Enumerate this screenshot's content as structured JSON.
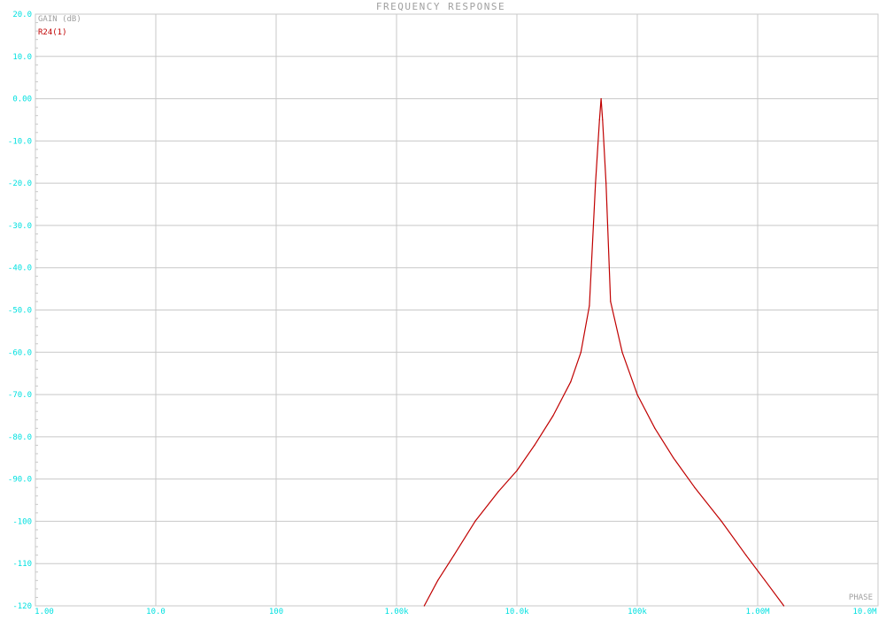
{
  "window": {
    "title": "FREQUENCY RESPONSE",
    "y_axis_title": "GAIN (dB)",
    "series_label": "R24(1)",
    "secondary_label": "PHASE"
  },
  "colors": {
    "background": "#ffffff",
    "grid": "#c8c8c8",
    "tick_text": "#00e0e0",
    "title_text": "#a0a0a0",
    "series": "#c00000"
  },
  "chart_data": {
    "type": "line",
    "title": "FREQUENCY RESPONSE",
    "xlabel": "",
    "ylabel": "GAIN (dB)",
    "x_scale": "log",
    "xlim": [
      1,
      10000000
    ],
    "ylim": [
      -120,
      20
    ],
    "grid": true,
    "x_ticks": [
      {
        "value": 1,
        "label": "1.00"
      },
      {
        "value": 10,
        "label": "10.0"
      },
      {
        "value": 100,
        "label": "100"
      },
      {
        "value": 1000,
        "label": "1.00k"
      },
      {
        "value": 10000,
        "label": "10.0k"
      },
      {
        "value": 100000,
        "label": "100k"
      },
      {
        "value": 1000000,
        "label": "1.00M"
      },
      {
        "value": 10000000,
        "label": "10.0M"
      }
    ],
    "y_ticks": [
      {
        "value": 20,
        "label": "20.0"
      },
      {
        "value": 10,
        "label": "10.0"
      },
      {
        "value": 0,
        "label": "0.00"
      },
      {
        "value": -10,
        "label": "-10.0"
      },
      {
        "value": -20,
        "label": "-20.0"
      },
      {
        "value": -30,
        "label": "-30.0"
      },
      {
        "value": -40,
        "label": "-40.0"
      },
      {
        "value": -50,
        "label": "-50.0"
      },
      {
        "value": -60,
        "label": "-60.0"
      },
      {
        "value": -70,
        "label": "-70.0"
      },
      {
        "value": -80,
        "label": "-80.0"
      },
      {
        "value": -90,
        "label": "-90.0"
      },
      {
        "value": -100,
        "label": "-100"
      },
      {
        "value": -110,
        "label": "-110"
      },
      {
        "value": -120,
        "label": "-120"
      }
    ],
    "series": [
      {
        "name": "R24(1)",
        "x": [
          1700,
          2200,
          3000,
          4500,
          7000,
          10000,
          14000,
          20000,
          28000,
          34000,
          40000,
          45000,
          48500,
          50000,
          51500,
          55000,
          60000,
          75000,
          100000,
          140000,
          200000,
          300000,
          500000,
          800000,
          1150000,
          1650000
        ],
        "y": [
          -120,
          -114,
          -108,
          -100,
          -93,
          -88,
          -82,
          -75,
          -67,
          -60,
          -49,
          -20,
          -5,
          0,
          -5,
          -20,
          -48,
          -60,
          -70,
          -78,
          -85,
          -92,
          -100,
          -108,
          -114,
          -120
        ]
      }
    ]
  }
}
